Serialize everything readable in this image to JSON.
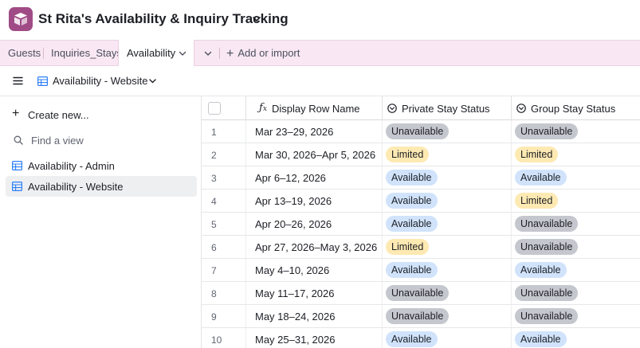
{
  "app": {
    "title": "St Rita's Availability & Inquiry Tracking"
  },
  "tabs": {
    "items": [
      "Guests",
      "Inquiries_Stays"
    ],
    "active": "Availability",
    "add_label": "Add or import"
  },
  "viewbar": {
    "view_name": "Availability - Website"
  },
  "sidebar": {
    "create_label": "Create new...",
    "find_placeholder": "Find a view",
    "views": [
      "Availability - Admin",
      "Availability - Website"
    ],
    "selected_view": "Availability - Website"
  },
  "grid": {
    "columns": [
      "Display Row Name",
      "Private Stay Status",
      "Group Stay Status"
    ],
    "rows": [
      {
        "num": "1",
        "name": "Mar 23–29, 2026",
        "private": "Unavailable",
        "group": "Unavailable"
      },
      {
        "num": "2",
        "name": "Mar 30, 2026–Apr 5, 2026",
        "private": "Limited",
        "group": "Limited"
      },
      {
        "num": "3",
        "name": "Apr 6–12, 2026",
        "private": "Available",
        "group": "Available"
      },
      {
        "num": "4",
        "name": "Apr 13–19, 2026",
        "private": "Available",
        "group": "Limited"
      },
      {
        "num": "5",
        "name": "Apr 20–26, 2026",
        "private": "Available",
        "group": "Unavailable"
      },
      {
        "num": "6",
        "name": "Apr 27, 2026–May 3, 2026",
        "private": "Limited",
        "group": "Unavailable"
      },
      {
        "num": "7",
        "name": "May 4–10, 2026",
        "private": "Available",
        "group": "Available"
      },
      {
        "num": "8",
        "name": "May 11–17, 2026",
        "private": "Unavailable",
        "group": "Unavailable"
      },
      {
        "num": "9",
        "name": "May 18–24, 2026",
        "private": "Unavailable",
        "group": "Unavailable"
      },
      {
        "num": "10",
        "name": "May 25–31, 2026",
        "private": "Available",
        "group": "Available"
      }
    ]
  },
  "colors": {
    "brand": "#a04b86",
    "tabs_bg": "#f9e8f4",
    "unavailable": "#c4c7cd",
    "limited": "#fde9b2",
    "available": "#d0e3fb"
  }
}
